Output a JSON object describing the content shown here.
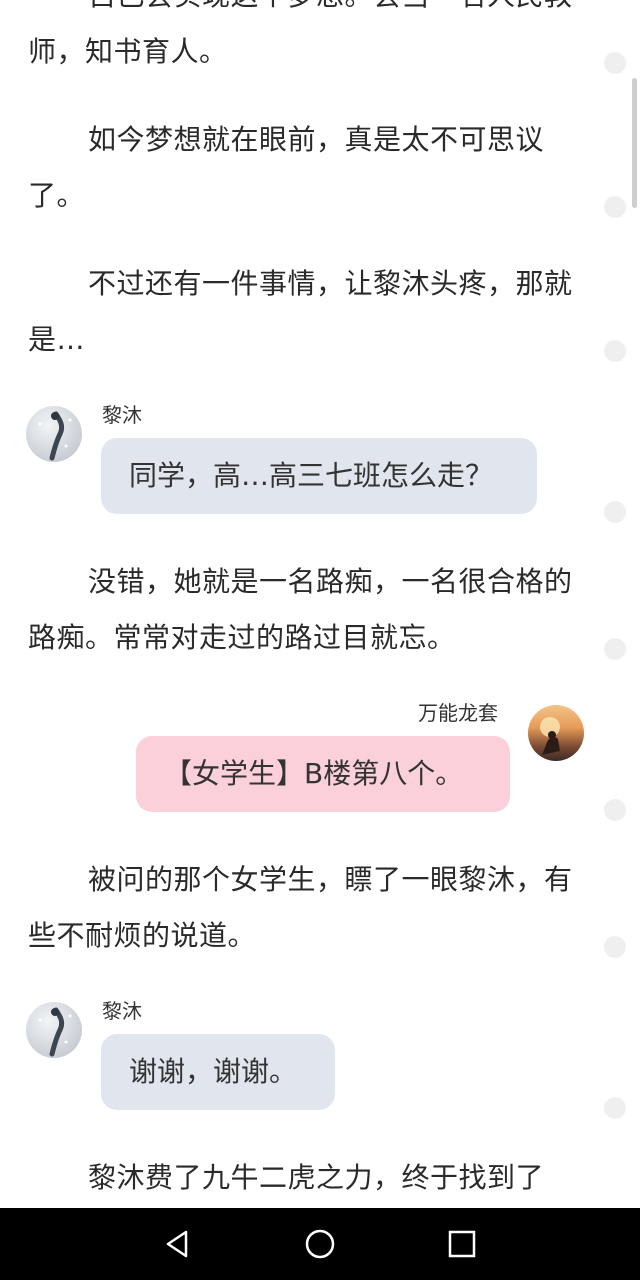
{
  "paragraphs": [
    "自己会实现这个梦想。会当一名人民教师，知书育人。",
    "如今梦想就在眼前，真是太不可思议了。",
    "不过还有一件事情，让黎沐头疼，那就是…",
    "没错，她就是一名路痴，一名很合格的路痴。常常对走过的路过目就忘。",
    "被问的那个女学生，瞟了一眼黎沐，有些不耐烦的说道。",
    "黎沐费了九牛二虎之力，终于找到了"
  ],
  "messages": [
    {
      "speaker": "黎沐",
      "text": "同学，高…高三七班怎么走？",
      "side": "left",
      "avatar": "snowy-figure-avatar"
    },
    {
      "speaker": "万能龙套",
      "text": "【女学生】B楼第八个。",
      "side": "right",
      "avatar": "sunset-silhouette-avatar"
    },
    {
      "speaker": "黎沐",
      "text": "谢谢，谢谢。",
      "side": "left",
      "avatar": "snowy-figure-avatar"
    }
  ],
  "nav": {
    "back_icon": "triangle-back-icon",
    "home_icon": "circle-home-icon",
    "recents_icon": "square-recents-icon"
  },
  "colors": {
    "left_bubble": "#e1e6ee",
    "right_bubble": "#fbd0da",
    "navbar": "#000000"
  }
}
